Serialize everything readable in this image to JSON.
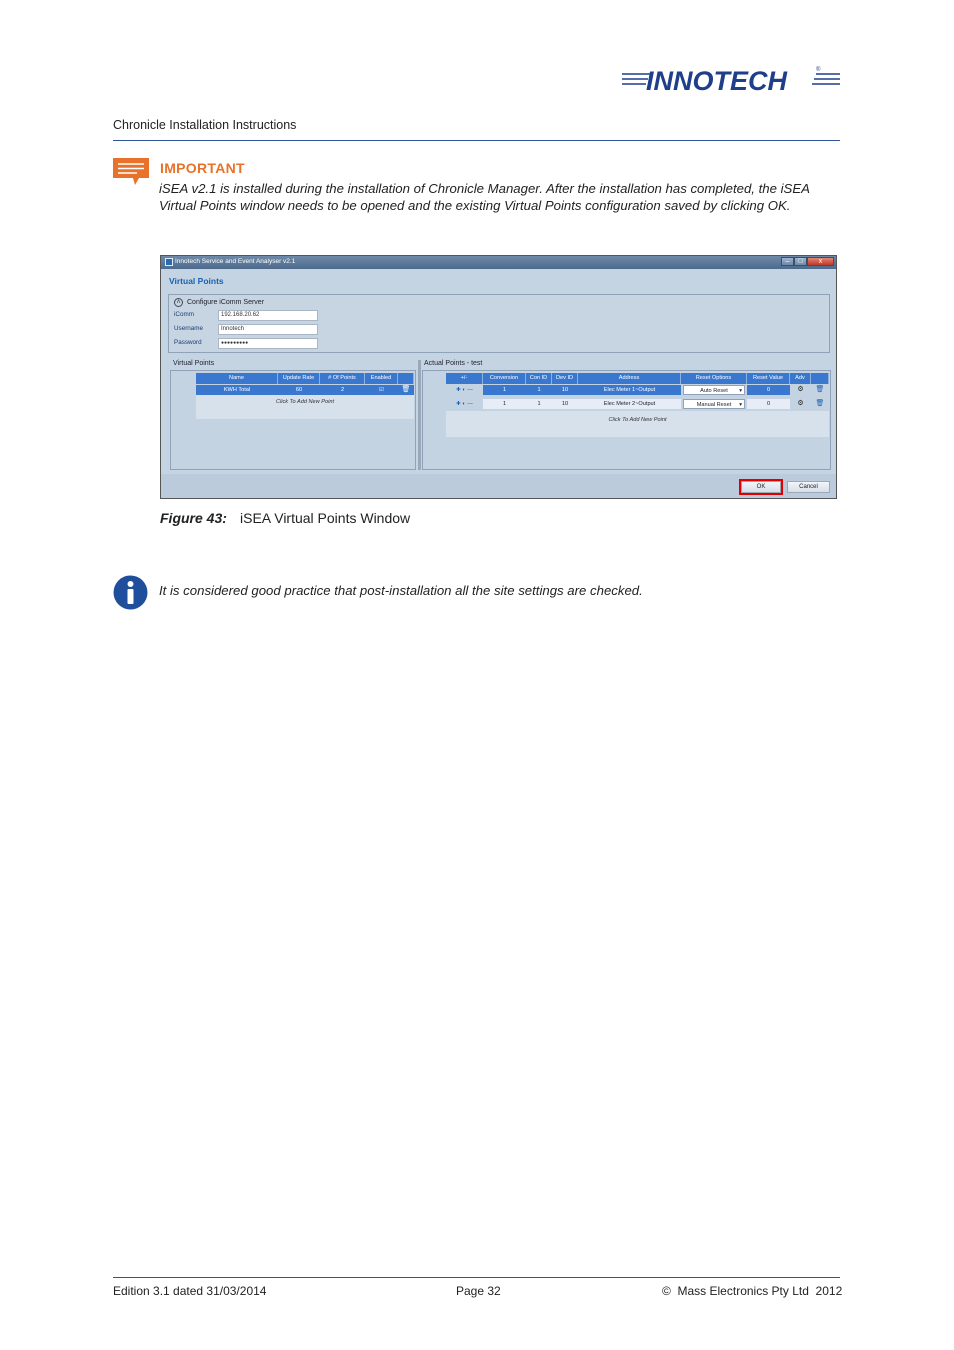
{
  "header": {
    "logo_text": "INNOTECH",
    "logo_registered_mark": "®",
    "doc_title": "Chronicle Installation Instructions"
  },
  "important": {
    "title": "IMPORTANT",
    "text": "iSEA v2.1 is installed during the installation of Chronicle Manager. After the installation has completed, the iSEA Virtual Points window needs to be opened and the existing Virtual Points configuration saved by clicking OK.",
    "icon": "speech-bubble-lines-icon",
    "color": "#e8722a"
  },
  "screenshot": {
    "window_title": "Innotech Service and Event Analyser v2.1",
    "heading": "Virtual Points",
    "icomm_section": {
      "heading": "Configure iComm Server",
      "fields": [
        {
          "label": "iComm",
          "value": "192.168.20.62"
        },
        {
          "label": "Username",
          "value": "Innotech"
        },
        {
          "label": "Password",
          "value": "●●●●●●●●●"
        }
      ]
    },
    "virtual_points": {
      "caption": "Virtual Points",
      "columns": [
        "Name",
        "Update Rate",
        "# Of Points",
        "Enabled"
      ],
      "rows": [
        {
          "name": "KWH Total",
          "update_rate": "60",
          "points": "2",
          "enabled": "☑"
        }
      ],
      "add_new": "Click To Add New Point"
    },
    "actual_points": {
      "caption": "Actual Points - test",
      "columns": [
        "+/-",
        "Conversion",
        "Con ID",
        "Dev ID",
        "Address",
        "Reset Options",
        "Reset Value",
        "Adv"
      ],
      "rows": [
        {
          "conversion": "1",
          "con_id": "1",
          "dev_id": "10",
          "address": "Elec Meter 1~Output",
          "reset_option": "Auto Reset",
          "reset_value": "0"
        },
        {
          "conversion": "1",
          "con_id": "1",
          "dev_id": "10",
          "address": "Elec Meter 2~Output",
          "reset_option": "Manual Reset",
          "reset_value": "0"
        }
      ],
      "add_new": "Click To Add New Point"
    },
    "buttons": {
      "ok": "OK",
      "cancel": "Cancel"
    },
    "highlight_color": "#e00000"
  },
  "figure": {
    "label": "Figure 43:",
    "caption": "iSEA Virtual Points Window"
  },
  "note": {
    "icon": "info-icon",
    "text": "It is considered good practice that post-installation all the site settings are checked."
  },
  "footer": {
    "edition": "Edition 3.1 dated 31/03/2014",
    "page": "Page 32",
    "copyright": "©  Mass Electronics Pty Ltd  2012"
  },
  "colors": {
    "rule": "#2f5597",
    "accent_orange": "#e8722a",
    "grid_selected": "#3a78d0",
    "info_blue": "#1f4e9c"
  }
}
